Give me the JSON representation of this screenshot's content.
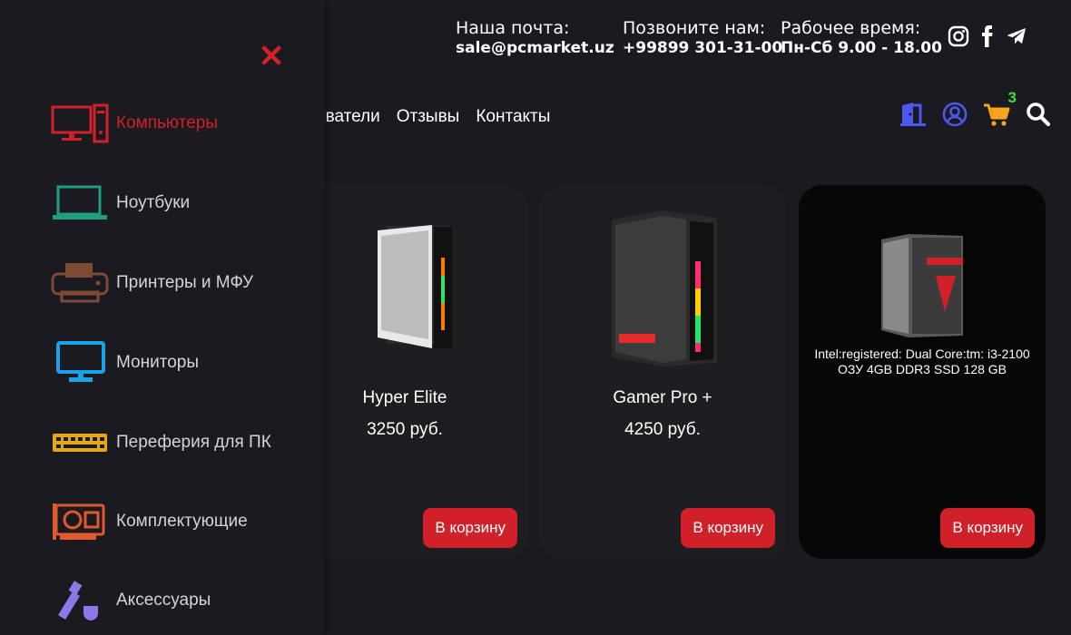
{
  "header": {
    "email_label": "Наша почта:",
    "email": "sale@pcmarket.uz",
    "phone_label": "Позвоните нам:",
    "phone": "+99899 301-31-00",
    "hours_label": "Рабочее время:",
    "hours": "Пн-Сб 9.00 - 18.00",
    "social": [
      "instagram-icon",
      "facebook-icon",
      "telegram-icon"
    ]
  },
  "nav": {
    "items": [
      "ователи",
      "Отзывы",
      "Контакты"
    ]
  },
  "header_icons": {
    "cart_count": "3",
    "colors": {
      "door": "#4b57f0",
      "user": "#4b57f0",
      "cart": "#f7a51b",
      "search": "#ffffff"
    }
  },
  "products": [
    {
      "name": "Hyper Elite",
      "price": "3250 руб.",
      "button": "В корзину"
    },
    {
      "name": "Gamer Pro +",
      "price": "4250 руб.",
      "button": "В корзину"
    },
    {
      "description": "Intel:registered: Dual Core:tm: i3-2100 ОЗУ 4GB DDR3 SSD 128 GB",
      "button": "В корзину"
    }
  ],
  "sidebar": {
    "items": [
      {
        "label": "Компьютеры",
        "icon": "computer-icon",
        "active": true
      },
      {
        "label": "Ноутбуки",
        "icon": "laptop-icon"
      },
      {
        "label": "Принтеры и МФУ",
        "icon": "printer-icon"
      },
      {
        "label": "Мониторы",
        "icon": "monitor-icon"
      },
      {
        "label": "Переферия для ПК",
        "icon": "keyboard-icon"
      },
      {
        "label": "Комплектующие",
        "icon": "gpu-icon"
      },
      {
        "label": "Аксессуары",
        "icon": "usb-accessory-icon"
      }
    ]
  },
  "colors": {
    "accent": "#d0202a",
    "background": "#1b1a20"
  }
}
